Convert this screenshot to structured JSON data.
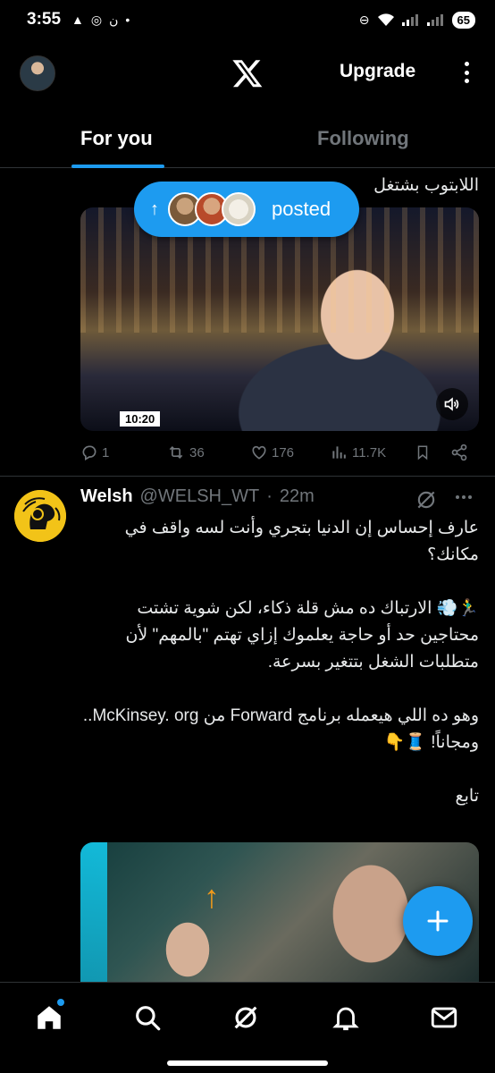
{
  "status_bar": {
    "time": "3:55",
    "battery": "65"
  },
  "header": {
    "upgrade_label": "Upgrade"
  },
  "tabs": [
    {
      "label": "For you",
      "active": true
    },
    {
      "label": "Following",
      "active": false
    }
  ],
  "tweet1": {
    "text": "اللابتوب بشتغل",
    "video_time": "10:20",
    "posted_label": "posted",
    "actions": {
      "replies": "1",
      "reposts": "36",
      "likes": "176",
      "views": "11.7K"
    }
  },
  "tweet2": {
    "name": "Welsh",
    "handle": "@WELSH_WT",
    "dot": "·",
    "time": "22m",
    "lines": [
      "عارف إحساس إن الدنيا بتجري وأنت لسه واقف في مكانك؟",
      "",
      "🏃‍♂️💨 الارتباك ده مش قلة ذكاء، لكن شوية تشتت محتاجين حد أو حاجة يعلموك إزاي تهتم \"بالمهم\" لأن متطلبات الشغل بتتغير بسرعة.",
      "",
      "وهو ده اللي هيعمله برنامج Forward من McKinsey. org.. ومجاناً! 🧵👇",
      "",
      "تابع"
    ]
  },
  "colors": {
    "accent": "#1d9bf0",
    "background": "#000000",
    "muted": "#71767b"
  },
  "nav": [
    "home-icon",
    "search-icon",
    "grok-icon",
    "notifications-icon",
    "messages-icon"
  ]
}
